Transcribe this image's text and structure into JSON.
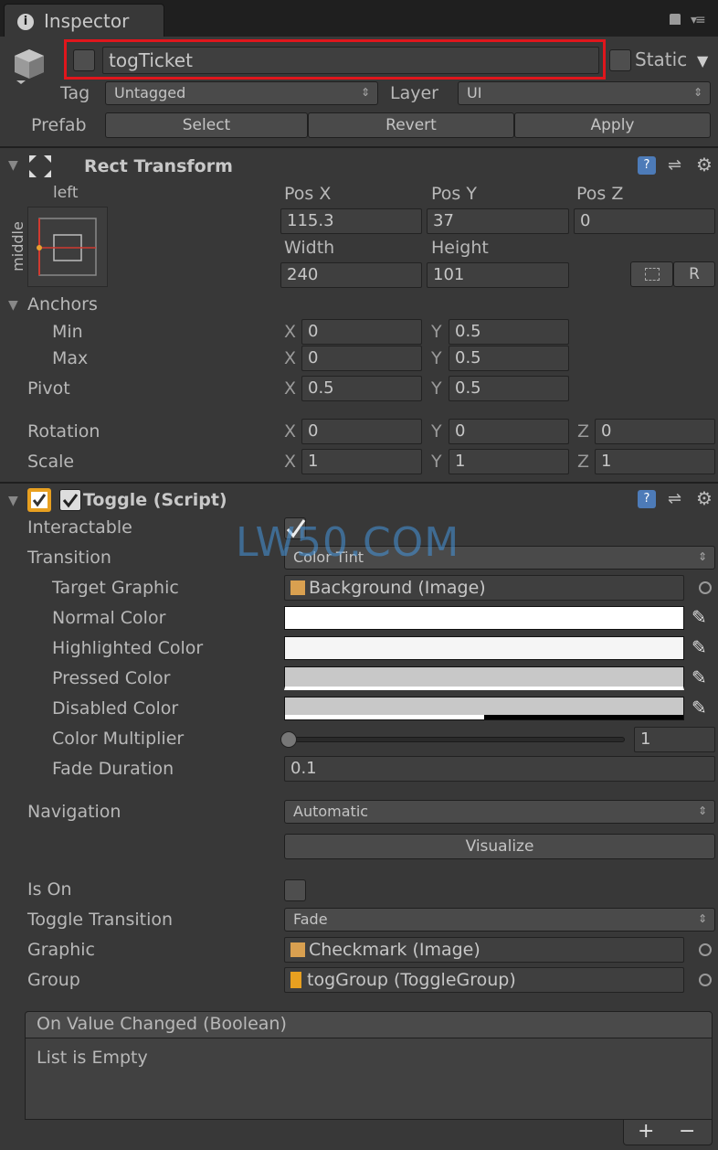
{
  "window": {
    "tab_title": "Inspector"
  },
  "header": {
    "object_name": "togTicket",
    "static_label": "Static",
    "tag_label": "Tag",
    "tag_value": "Untagged",
    "layer_label": "Layer",
    "layer_value": "UI",
    "prefab_label": "Prefab",
    "select_label": "Select",
    "revert_label": "Revert",
    "apply_label": "Apply"
  },
  "rect": {
    "title": "Rect Transform",
    "anchor_h": "left",
    "anchor_v": "middle",
    "posx_label": "Pos X",
    "posy_label": "Pos Y",
    "posz_label": "Pos Z",
    "posx": "115.3",
    "posy": "37",
    "posz": "0",
    "width_label": "Width",
    "height_label": "Height",
    "width": "240",
    "height": "101",
    "r_label": "R",
    "anchors_label": "Anchors",
    "min_label": "Min",
    "max_label": "Max",
    "min_x": "0",
    "min_y": "0.5",
    "max_x": "0",
    "max_y": "0.5",
    "pivot_label": "Pivot",
    "pivot_x": "0.5",
    "pivot_y": "0.5",
    "rotation_label": "Rotation",
    "rot_x": "0",
    "rot_y": "0",
    "rot_z": "0",
    "scale_label": "Scale",
    "scale_x": "1",
    "scale_y": "1",
    "scale_z": "1",
    "x": "X",
    "y": "Y",
    "z": "Z"
  },
  "toggle": {
    "title": "Toggle (Script)",
    "interactable_label": "Interactable",
    "transition_label": "Transition",
    "transition_value": "Color Tint",
    "target_graphic_label": "Target Graphic",
    "target_graphic_value": "Background (Image)",
    "normal_color_label": "Normal Color",
    "highlighted_color_label": "Highlighted Color",
    "pressed_color_label": "Pressed Color",
    "disabled_color_label": "Disabled Color",
    "color_multiplier_label": "Color Multiplier",
    "color_multiplier_value": "1",
    "color_multiplier_level": 0,
    "fade_duration_label": "Fade Duration",
    "fade_duration_value": "0.1",
    "navigation_label": "Navigation",
    "navigation_value": "Automatic",
    "visualize_label": "Visualize",
    "is_on_label": "Is On",
    "toggle_transition_label": "Toggle Transition",
    "toggle_transition_value": "Fade",
    "graphic_label": "Graphic",
    "graphic_value": "Checkmark (Image)",
    "group_label": "Group",
    "group_value": "togGroup (ToggleGroup)"
  },
  "event": {
    "title": "On Value Changed (Boolean)",
    "empty_text": "List is Empty",
    "add": "+",
    "remove": "−"
  },
  "colors": {
    "normal": "#ffffff",
    "highlighted": "#f5f5f5",
    "pressed": "#c8c8c8",
    "disabled": "#c8c8c8",
    "highlight_box": "#e0161c"
  },
  "watermark": "LW50.COM"
}
